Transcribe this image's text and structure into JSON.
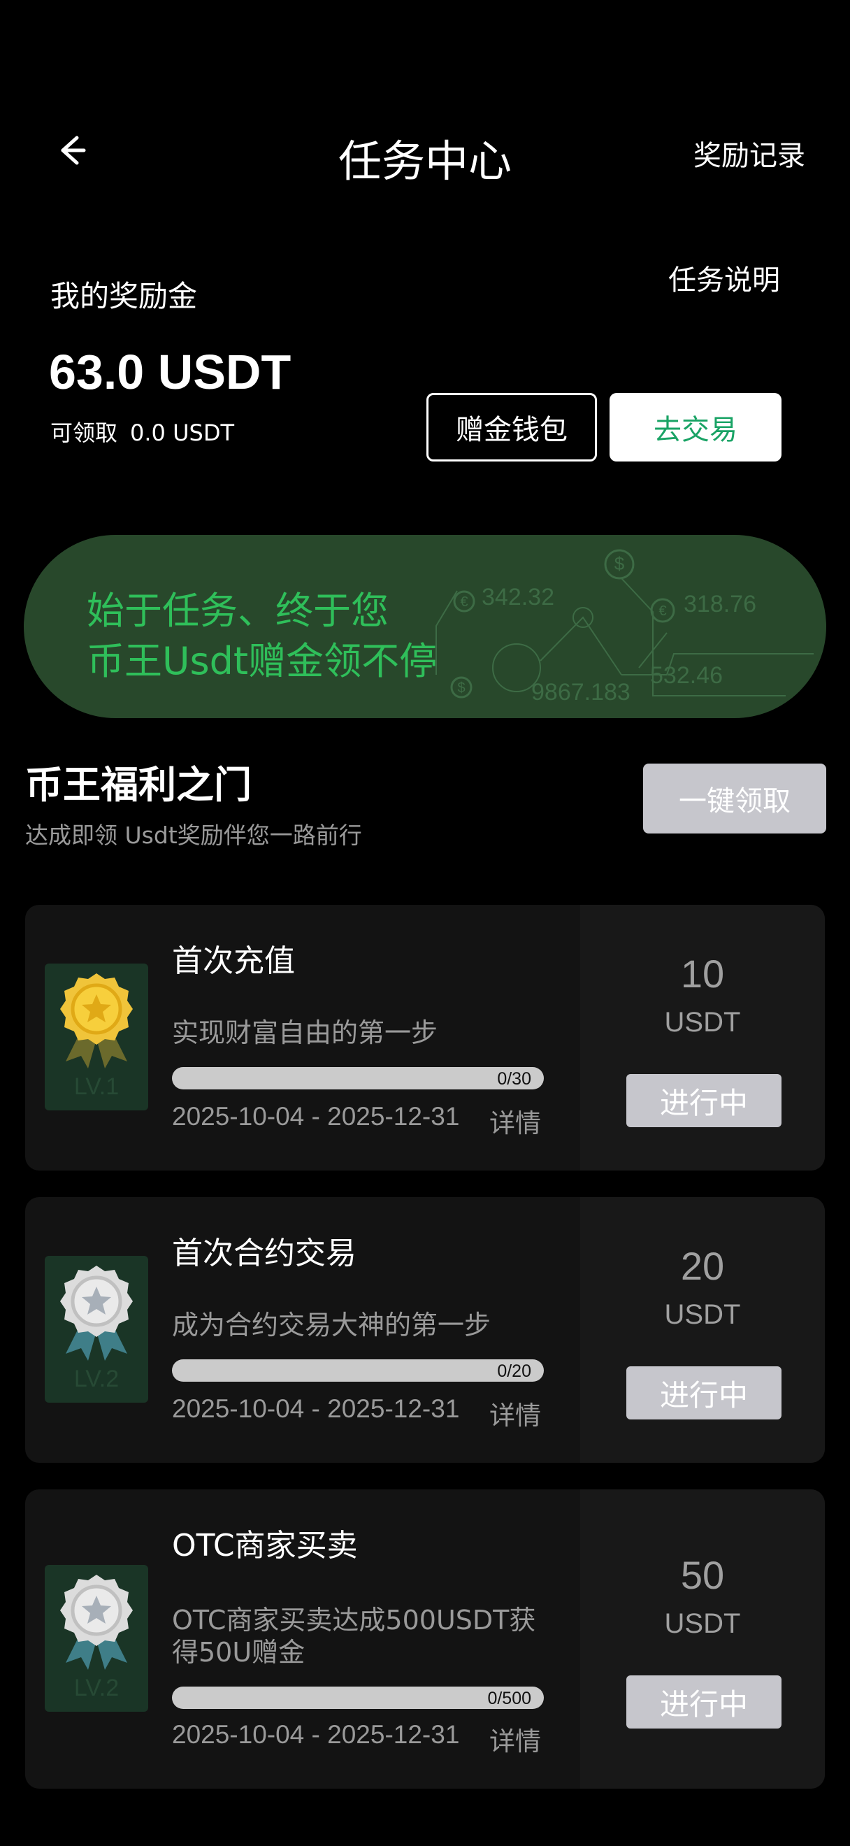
{
  "header": {
    "title": "任务中心",
    "records_label": "奖励记录"
  },
  "bonus": {
    "label": "我的奖励金",
    "amount": "63.0 USDT",
    "claimable_label": "可领取",
    "claimable_amount": "0.0 USDT",
    "task_desc_label": "任务说明",
    "wallet_button": "赠金钱包",
    "trade_button": "去交易"
  },
  "banner": {
    "line1": "始于任务、终于您",
    "line2": "币王Usdt赠金领不停",
    "numbers": [
      "342.32",
      "318.76",
      "9867.183",
      "532.46"
    ]
  },
  "section": {
    "title": "币王福利之门",
    "subtitle": "达成即领 Usdt奖励伴您一路前行",
    "claim_all_button": "一键领取"
  },
  "tasks": [
    {
      "name": "首次充值",
      "desc": "实现财富自由的第一步",
      "progress": "0/30",
      "progress_fraction": 0,
      "date": "2025-10-04 - 2025-12-31",
      "detail": "详情",
      "reward": "10",
      "unit": "USDT",
      "status": "进行中",
      "level": "LV.1",
      "medal": "gold-medal-icon"
    },
    {
      "name": "首次合约交易",
      "desc": "成为合约交易大神的第一步",
      "progress": "0/20",
      "progress_fraction": 0,
      "date": "2025-10-04 - 2025-12-31",
      "detail": "详情",
      "reward": "20",
      "unit": "USDT",
      "status": "进行中",
      "level": "LV.2",
      "medal": "silver-medal-icon"
    },
    {
      "name": "OTC商家买卖",
      "desc": "OTC商家买卖达成500USDT获得50U赠金",
      "progress": "0/500",
      "progress_fraction": 0,
      "date": "2025-10-04 - 2025-12-31",
      "detail": "详情",
      "reward": "50",
      "unit": "USDT",
      "status": "进行中",
      "level": "LV.2",
      "medal": "silver-medal-icon"
    }
  ],
  "colors": {
    "accent_green": "#19a365",
    "banner_bg": "#28482b",
    "banner_text": "#2fbf5a",
    "disabled_button": "#c6c6cc"
  }
}
